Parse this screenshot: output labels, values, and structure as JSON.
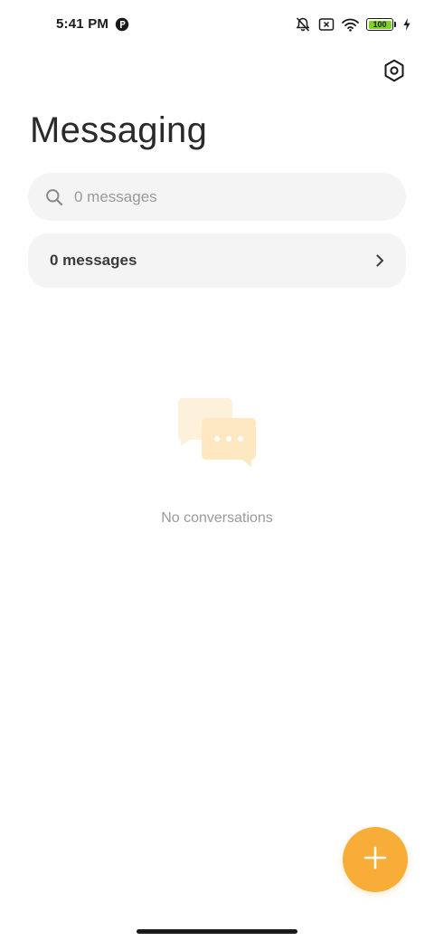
{
  "status_bar": {
    "time": "5:41 PM",
    "battery_level": "100",
    "battery_fill_fraction": 1.0,
    "battery_color": "#7dd321",
    "icons": [
      "app-notification-icon",
      "bell-off-icon",
      "no-sim-icon",
      "wifi-icon",
      "battery-icon",
      "charging-icon"
    ]
  },
  "header": {
    "settings_icon": "settings-hexagon-icon",
    "title": "Messaging"
  },
  "search": {
    "placeholder": "0 messages",
    "icon": "search-icon"
  },
  "messages_row": {
    "label": "0 messages",
    "icon": "chevron-right-icon"
  },
  "empty_state": {
    "icon": "conversations-icon",
    "text": "No conversations"
  },
  "fab": {
    "icon": "plus-icon",
    "color": "#f7ad37"
  },
  "colors": {
    "accent": "#f7ad37",
    "surface": "#f4f4f4",
    "muted_text": "#9a9a9a"
  }
}
